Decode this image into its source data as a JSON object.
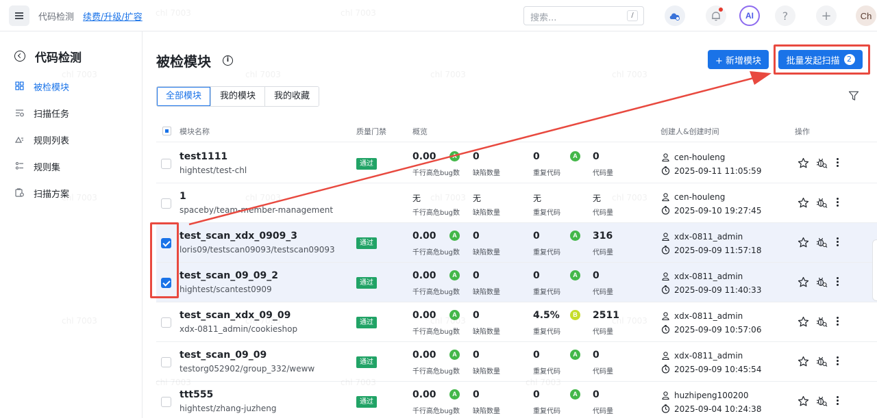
{
  "topbar": {
    "crumb": "代码检测",
    "renew_link": "续费/升级/扩容",
    "search_placeholder": "搜索...",
    "search_shortcut": "/",
    "ai_label": "AI",
    "help_label": "?",
    "plus_label": "+",
    "avatar_label": "Ch"
  },
  "sidebar": {
    "title": "代码检测",
    "items": [
      {
        "label": "被检模块",
        "icon": "grid-icon",
        "active": true
      },
      {
        "label": "扫描任务",
        "icon": "scan-task-icon",
        "active": false
      },
      {
        "label": "规则列表",
        "icon": "rule-list-icon",
        "active": false
      },
      {
        "label": "规则集",
        "icon": "ruleset-icon",
        "active": false
      },
      {
        "label": "扫描方案",
        "icon": "scan-plan-icon",
        "active": false
      }
    ]
  },
  "main": {
    "title": "被检模块",
    "info_glyph": "i",
    "add_button": "+ 新增模块",
    "batch_button": "批量发起扫描",
    "batch_count": "2",
    "tabs": [
      "全部模块",
      "我的模块",
      "我的收藏"
    ],
    "active_tab": 0
  },
  "table": {
    "headers": {
      "name": "模块名称",
      "gate": "质量门禁",
      "overview": "概览",
      "creator": "创建人&创建时间",
      "actions": "操作"
    },
    "metric_labels": {
      "bug": "千行高危bug数",
      "defect": "缺陷数量",
      "dup": "重复代码",
      "loc": "代码量"
    },
    "rows": [
      {
        "name": "test1111",
        "path": "hightest/test-chl",
        "gate": "通过",
        "bug": "0.00",
        "bug_grade": "A",
        "defect": "0",
        "dup": "0",
        "dup_grade": "A",
        "loc": "0",
        "creator": "cen-houleng",
        "time": "2025-09-11 11:05:59",
        "selected": false
      },
      {
        "name": "1",
        "path": "spaceby/team-member-management",
        "gate": "",
        "bug": "无",
        "bug_grade": "",
        "defect": "无",
        "dup": "无",
        "dup_grade": "",
        "loc": "无",
        "creator": "cen-houleng",
        "time": "2025-09-10 19:27:45",
        "selected": false
      },
      {
        "name": "test_scan_xdx_0909_3",
        "path": "loris09/testscan09093/testscan09093",
        "gate": "通过",
        "bug": "0.00",
        "bug_grade": "A",
        "defect": "0",
        "dup": "0",
        "dup_grade": "A",
        "loc": "316",
        "creator": "xdx-0811_admin",
        "time": "2025-09-09 11:57:18",
        "selected": true
      },
      {
        "name": "test_scan_09_09_2",
        "path": "hightest/scantest0909",
        "gate": "通过",
        "bug": "0.00",
        "bug_grade": "A",
        "defect": "0",
        "dup": "0",
        "dup_grade": "A",
        "loc": "0",
        "creator": "xdx-0811_admin",
        "time": "2025-09-09 11:40:33",
        "selected": true
      },
      {
        "name": "test_scan_xdx_09_09",
        "path": "xdx-0811_admin/cookieshop",
        "gate": "通过",
        "bug": "0.00",
        "bug_grade": "A",
        "defect": "0",
        "dup": "4.5%",
        "dup_grade": "B",
        "loc": "2511",
        "creator": "xdx-0811_admin",
        "time": "2025-09-09 10:57:06",
        "selected": false
      },
      {
        "name": "test_scan_09_09",
        "path": "testorg052902/group_332/weww",
        "gate": "通过",
        "bug": "0.00",
        "bug_grade": "A",
        "defect": "0",
        "dup": "0",
        "dup_grade": "A",
        "loc": "0",
        "creator": "xdx-0811_admin",
        "time": "2025-09-09 10:45:54",
        "selected": false
      },
      {
        "name": "ttt555",
        "path": "hightest/zhang-juzheng",
        "gate": "通过",
        "bug": "0.00",
        "bug_grade": "A",
        "defect": "0",
        "dup": "0",
        "dup_grade": "A",
        "loc": "0",
        "creator": "huzhipeng100200",
        "time": "2025-09-04 10:24:38",
        "selected": false
      }
    ]
  },
  "watermark": "chl 7003",
  "colors": {
    "primary": "#1a73e8",
    "gate_pass": "#21a366",
    "grade_a": "#43b749",
    "grade_b": "#c6dd2b",
    "annotation_red": "#e8493f",
    "selected_row": "#eef2fb"
  }
}
